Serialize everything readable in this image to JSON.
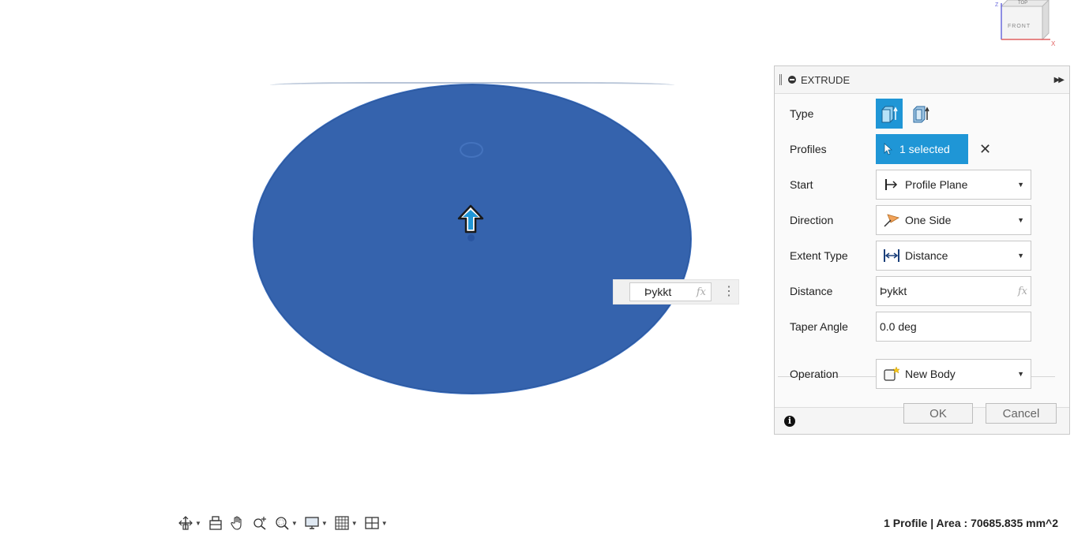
{
  "viewcube": {
    "top_label": "TOP",
    "front_label": "FRONT",
    "z_axis": "Z",
    "x_axis": "X"
  },
  "float_input": {
    "value": "Þykkt",
    "fx": "fx"
  },
  "panel": {
    "title": "EXTRUDE",
    "rows": {
      "type": {
        "label": "Type"
      },
      "profiles": {
        "label": "Profiles",
        "selection": "1 selected",
        "clear": "✕"
      },
      "start": {
        "label": "Start",
        "value": "Profile Plane"
      },
      "direction": {
        "label": "Direction",
        "value": "One Side"
      },
      "extent_type": {
        "label": "Extent Type",
        "value": "Distance"
      },
      "distance": {
        "label": "Distance",
        "value": "Þykkt",
        "fx": "fx"
      },
      "taper_angle": {
        "label": "Taper Angle",
        "value": "0.0 deg"
      },
      "operation": {
        "label": "Operation",
        "value": "New Body"
      }
    },
    "ok_label": "OK",
    "cancel_label": "Cancel",
    "info_symbol": "i"
  },
  "toolbar": {
    "tools": [
      "orbit-icon",
      "look-at-icon",
      "pan-icon",
      "zoom-icon",
      "zoom-window-icon",
      "display-settings-icon",
      "grid-icon",
      "viewports-icon"
    ]
  },
  "status": {
    "text": "1 Profile | Area : 70685.835 mm^2"
  },
  "colors": {
    "accent": "#1f96d6",
    "body": "#3563ad"
  }
}
